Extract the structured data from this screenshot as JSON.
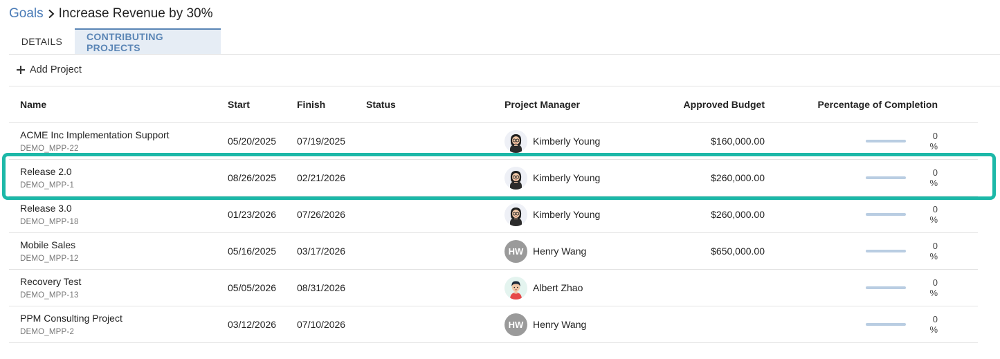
{
  "breadcrumb": {
    "parent": "Goals",
    "current": "Increase Revenue by 30%"
  },
  "tabs": [
    {
      "label": "DETAILS",
      "active": false
    },
    {
      "label": "CONTRIBUTING PROJECTS",
      "active": true
    }
  ],
  "toolbar": {
    "add_project_label": "Add Project"
  },
  "columns": {
    "name": "Name",
    "start": "Start",
    "finish": "Finish",
    "status": "Status",
    "pm": "Project Manager",
    "budget": "Approved Budget",
    "pct": "Percentage of Completion"
  },
  "rows": [
    {
      "name": "ACME Inc Implementation Support",
      "id": "DEMO_MPP-22",
      "start": "05/20/2025",
      "finish": "07/19/2025",
      "status": "",
      "pm": "Kimberly Young",
      "pm_avatar": "woman-glasses-avatar",
      "budget": "$160,000.00",
      "pct_label": "0 %",
      "pct_value": 0
    },
    {
      "name": "Release 2.0",
      "id": "DEMO_MPP-1",
      "start": "08/26/2025",
      "finish": "02/21/2026",
      "status": "",
      "pm": "Kimberly Young",
      "pm_avatar": "woman-glasses-avatar",
      "budget": "$260,000.00",
      "pct_label": "0 %",
      "pct_value": 0
    },
    {
      "name": "Release 3.0",
      "id": "DEMO_MPP-18",
      "start": "01/23/2026",
      "finish": "07/26/2026",
      "status": "",
      "pm": "Kimberly Young",
      "pm_avatar": "woman-glasses-avatar",
      "budget": "$260,000.00",
      "pct_label": "0 %",
      "pct_value": 0
    },
    {
      "name": "Mobile Sales",
      "id": "DEMO_MPP-12",
      "start": "05/16/2025",
      "finish": "03/17/2026",
      "status": "",
      "pm": "Henry Wang",
      "pm_avatar": "initials",
      "pm_initials": "HW",
      "budget": "$650,000.00",
      "pct_label": "0 %",
      "pct_value": 0
    },
    {
      "name": "Recovery Test",
      "id": "DEMO_MPP-13",
      "start": "05/05/2026",
      "finish": "08/31/2026",
      "status": "",
      "pm": "Albert Zhao",
      "pm_avatar": "man-avatar",
      "budget": "",
      "pct_label": "0 %",
      "pct_value": 0
    },
    {
      "name": "PPM Consulting Project",
      "id": "DEMO_MPP-2",
      "start": "03/12/2026",
      "finish": "07/10/2026",
      "status": "",
      "pm": "Henry Wang",
      "pm_avatar": "initials",
      "pm_initials": "HW",
      "budget": "",
      "pct_label": "0 %",
      "pct_value": 0
    }
  ],
  "highlighted_row": 1,
  "colors": {
    "accent": "#5a85b5",
    "link": "#4a7bb7",
    "highlight": "#1cb8a8",
    "progress_track": "#b9cde2"
  }
}
